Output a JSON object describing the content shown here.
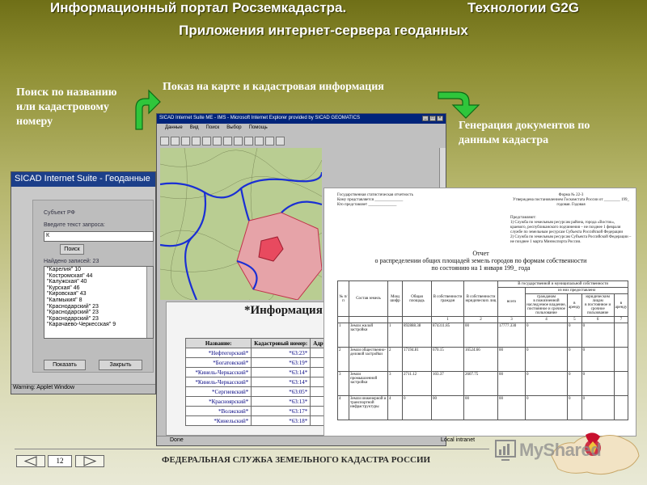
{
  "header": {
    "portal_title": "Информационный портал Росземкадастра.",
    "tech_title": "Технологии G2G",
    "subtitle": "Приложения интернет-сервера геоданных"
  },
  "captions": {
    "search": "Поиск по названию или кадастровому номеру",
    "map": "Показ на карте и кадастровая информация",
    "generation": "Генерация документов по данным кадастра"
  },
  "applet": {
    "title": "SICAD Internet Suite - Геоданные",
    "subject_label": "Субъект РФ",
    "query_label": "Введите текст запроса:",
    "query_value": "К",
    "search_button": "Поиск",
    "found_label": "Найдено записей:",
    "found_count": "23",
    "results": [
      "\"Карелия\" 10",
      "\"Костромская\" 44",
      "\"Калужская\" 40",
      "\"Курская\" 46",
      "\"Кировская\" 43",
      "\"Калмыкия\" 8",
      "\"Краснодарский\" 23",
      "\"Краснодарский\" 23",
      "\"Краснодарский\" 23",
      "\"Карачаево-Черкесская\" 9"
    ],
    "show_button": "Показать",
    "close_button": "Закрыть",
    "status": "Warning: Applet Window"
  },
  "browser": {
    "title": "SICAD Internet Suite ME - IMS - Microsoft Internet Explorer provided by SICAD GEOMATICS",
    "menu": [
      "Данные",
      "Вид",
      "Поиск",
      "Выбор",
      "Помощь"
    ],
    "info_heading": "*Информация",
    "table_headers": [
      "Название:",
      "Кадастровый номер:",
      "Адрес"
    ],
    "table_rows": [
      {
        "name": "*Нефтегорский*",
        "num": "*63:23*"
      },
      {
        "name": "*Богатовский*",
        "num": "*63:19*"
      },
      {
        "name": "*Кинель-Черкасский*",
        "num": "*63:14*"
      },
      {
        "name": "*Кинель-Черкасский*",
        "num": "*63:14*"
      },
      {
        "name": "*Сергиевский*",
        "num": "*63:05*"
      },
      {
        "name": "*Красноярский*",
        "num": "*63:13*"
      },
      {
        "name": "*Волжский*",
        "num": "*63:17*"
      },
      {
        "name": "*Кинельский*",
        "num": "*63:18*"
      }
    ],
    "status_done": "Done",
    "status_zone": "Local intranet"
  },
  "report": {
    "head_left": [
      "Государственная статистическая отчетность",
      "Кому представляется ______________",
      "Кто представляет ______________"
    ],
    "head_right": [
      "Форма № 22-3",
      "Утверждена постановлением Госкомстата России от ________ 199_",
      "годовая. Годовая"
    ],
    "recipients": [
      "Представляют:",
      "1) Служба по земельным ресурсам района, города «Восток»,",
      "краевого, республиканского подчинения – не позднее 1 февраля",
      "службе по земельным ресурсам Субъекта Российской Федерации",
      "2) Служба по земельным ресурсам Субъекта Российской Федерации –",
      "не позднее 1 марта Минэкспорта России."
    ],
    "title": "Отчет",
    "subtitle_line1": "о распределении общих площадей земель городов по формам собственности",
    "subtitle_line2": "по состоянию на 1 января 199_ года",
    "state_ownership_header": "В государственной и муниципальной собственности",
    "use_header": "из них предоставлено",
    "citizens_header": "гражданам",
    "legal_header": "юридическим лицам",
    "col_headers": [
      "№ п/п",
      "Состав земель",
      "Мощ шифр",
      "Общая площадь",
      "В собственности граждан",
      "В собственности юридических лиц",
      "всего",
      "в пожизненной наследуемое владение, постоянное и срочное пользование",
      "в аренду",
      "в постоянное и срочное пользование",
      "в аренду"
    ],
    "col_numbers": [
      "",
      "",
      "1",
      "2",
      "3",
      "4",
      "5",
      "6",
      "7",
      "8"
    ],
    "rows": [
      {
        "n": "1",
        "name": "Земли жилой застройки",
        "code": "1",
        "total": "892888.38",
        "citizens": "874311.85",
        "legal": "00",
        "all": "17777.330",
        "c6": "0",
        "c7": "0",
        "c8": "0"
      },
      {
        "n": "2",
        "name": "Земли общественно-деловой застройки",
        "code": "2",
        "total": "17194.81",
        "citizens": "670.15",
        "legal": "16524.66",
        "all": "00",
        "c6": "0",
        "c7": "0",
        "c8": "0"
      },
      {
        "n": "3",
        "name": "Земли промышленной застройки",
        "code": "3",
        "total": "2711.12",
        "citizens": "103.37",
        "legal": "2607.75",
        "all": "00",
        "c6": "0",
        "c7": "0",
        "c8": "0"
      },
      {
        "n": "4",
        "name": "Земли инженерной и транспортной инфраструктуры",
        "code": "4",
        "total": "0",
        "citizens": "00",
        "legal": "00",
        "all": "00",
        "c6": "0",
        "c7": "0",
        "c8": "0"
      }
    ]
  },
  "footer": {
    "page_number": "12",
    "agency": "ФЕДЕРАЛЬНАЯ СЛУЖБА ЗЕМЕЛЬНОГО КАДАСТРА РОССИИ",
    "watermark": "MyShared"
  },
  "colors": {
    "title_text": "#ffffff",
    "arrow_green": "#2fc63b",
    "map_region": "#e84a5f",
    "map_border": "#1a2fd4"
  }
}
